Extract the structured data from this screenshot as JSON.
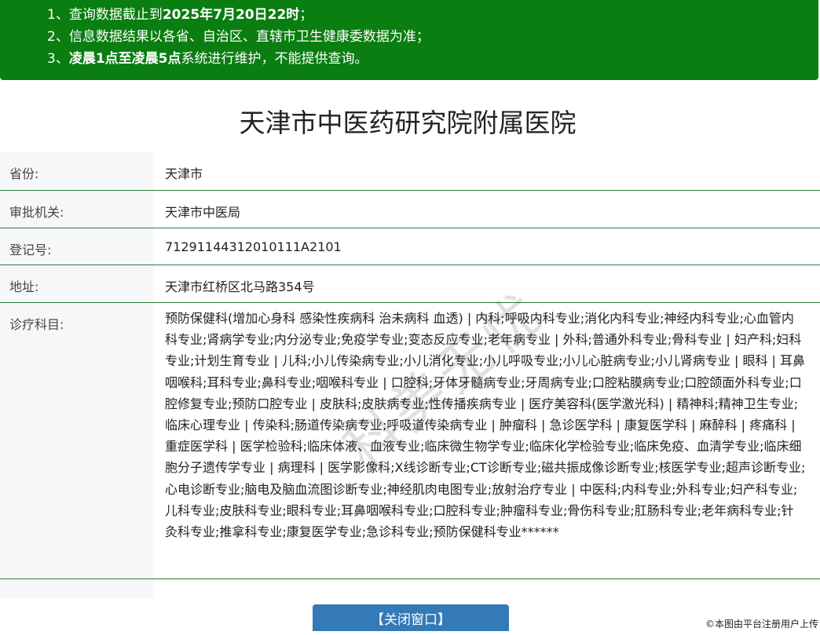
{
  "notice": {
    "line1_prefix": "1、查询数据截止到",
    "line1_bold": "2025年7月20日22时",
    "line1_suffix": "；",
    "line2": "2、信息数据结果以各省、自治区、直辖市卫生健康委数据为准；",
    "line3_prefix": "3、",
    "line3_bold": "凌晨1点至凌晨5点",
    "line3_suffix": "系统进行维护，不能提供查询。"
  },
  "hospital_title": "天津市中医药研究院附属医院",
  "info": {
    "province": {
      "label": "省份:",
      "value": "天津市"
    },
    "authority": {
      "label": "审批机关:",
      "value": "天津市中医局"
    },
    "registration": {
      "label": "登记号:",
      "value": "71291144312010111A2101"
    },
    "address": {
      "label": "地址:",
      "value": "天津市红桥区北马路354号"
    },
    "departments": {
      "label": "诊疗科目:",
      "value": "预防保健科(增加心身科 感染性疾病科 治未病科 血透) | 内科;呼吸内科专业;消化内科专业;神经内科专业;心血管内科专业;肾病学专业;内分泌专业;免疫学专业;变态反应专业;老年病专业 | 外科;普通外科专业;骨科专业 | 妇产科;妇科专业;计划生育专业 | 儿科;小儿传染病专业;小儿消化专业;小儿呼吸专业;小儿心脏病专业;小儿肾病专业 | 眼科 | 耳鼻咽喉科;耳科专业;鼻科专业;咽喉科专业 | 口腔科;牙体牙髓病专业;牙周病专业;口腔粘膜病专业;口腔颌面外科专业;口腔修复专业;预防口腔专业 | 皮肤科;皮肤病专业;性传播疾病专业 | 医疗美容科(医学激光科) | 精神科;精神卫生专业;临床心理专业 | 传染科;肠道传染病专业;呼吸道传染病专业 | 肿瘤科 | 急诊医学科 | 康复医学科 | 麻醉科 | 疼痛科 | 重症医学科 | 医学检验科;临床体液、血液专业;临床微生物学专业;临床化学检验专业;临床免疫、血清学专业;临床细胞分子遗传学专业 | 病理科 | 医学影像科;X线诊断专业;CT诊断专业;磁共振成像诊断专业;核医学专业;超声诊断专业;心电诊断专业;脑电及脑血流图诊断专业;神经肌肉电图专业;放射治疗专业 | 中医科;内科专业;外科专业;妇产科专业;儿科专业;皮肤科专业;眼科专业;耳鼻咽喉科专业;口腔科专业;肿瘤科专业;骨伤科专业;肛肠科专业;老年病科专业;针灸科专业;推拿科专业;康复医学专业;急诊科专业;预防保健科专业******"
    }
  },
  "close_button_label": "【关闭窗口】",
  "source_credit": "©本图由平台注册用户上传",
  "watermark": "科美无忧"
}
